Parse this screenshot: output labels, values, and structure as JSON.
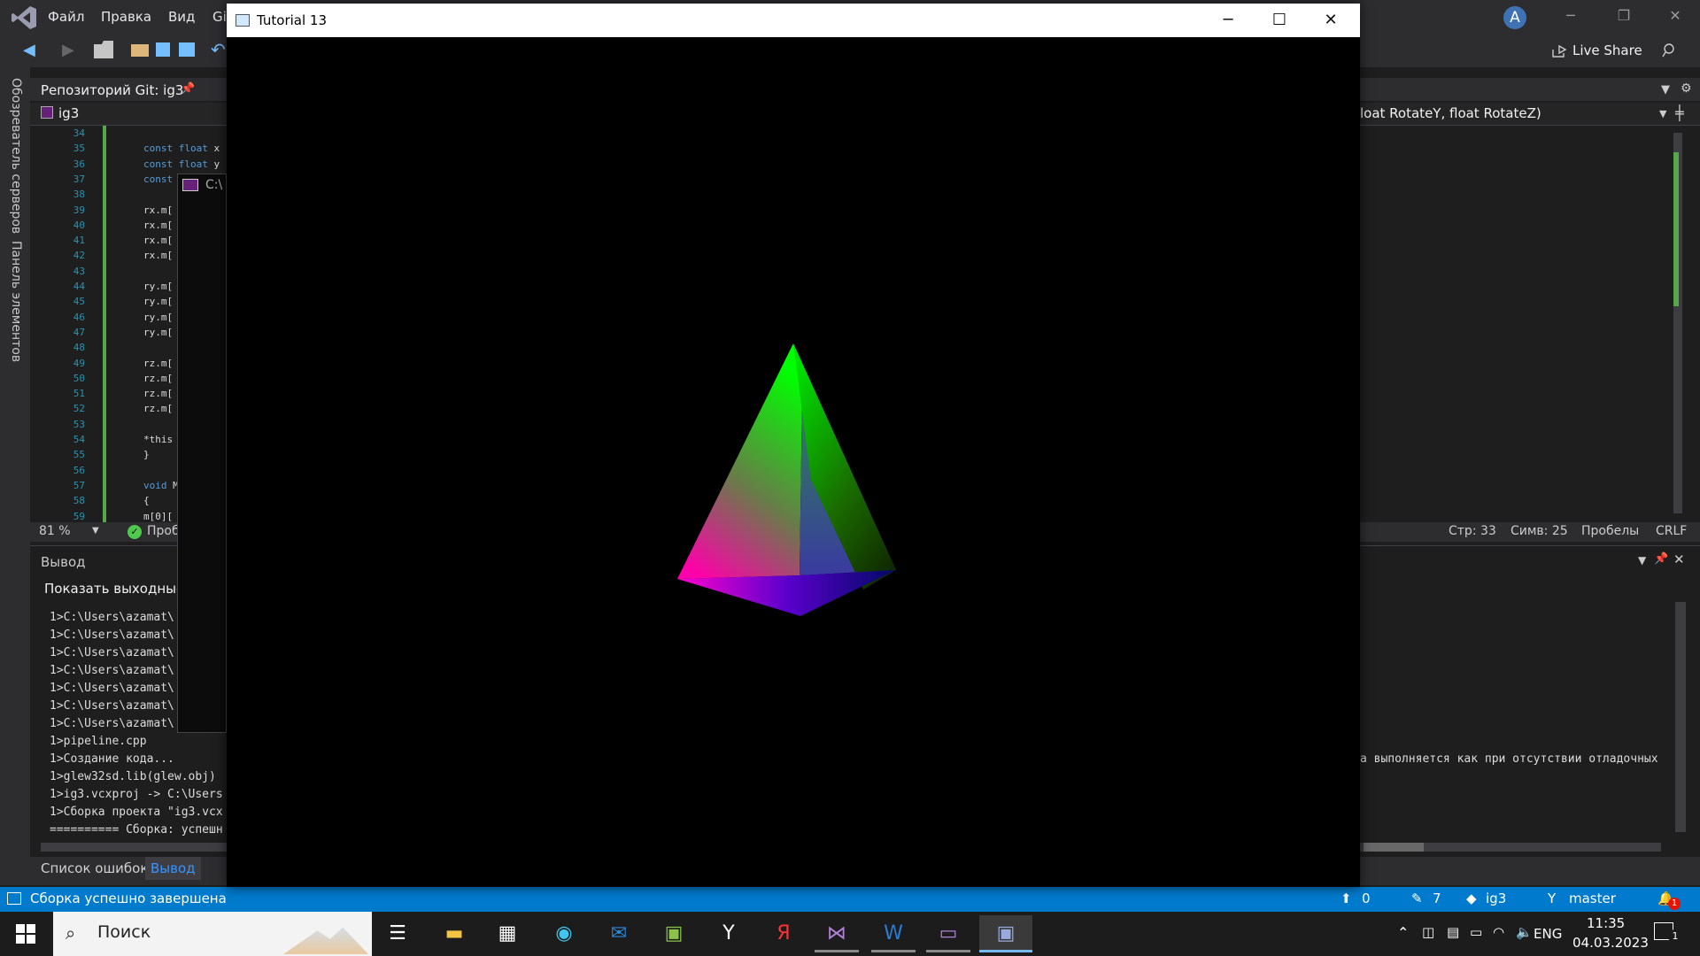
{
  "menu": [
    "Файл",
    "Правка",
    "Вид",
    "Git"
  ],
  "titlebar_controls": {
    "minimize": "─",
    "restore": "❐",
    "close": "✕"
  },
  "avatar_initial": "A",
  "live_share": "Live Share",
  "left_strip": {
    "server_explorer": "Обозреватель серверов",
    "toolbox": "Панель элементов"
  },
  "git_tab": "Репозиторий Git: ig3",
  "nav": {
    "project": "ig3",
    "member": "loat RotateY, float RotateZ)"
  },
  "editor": {
    "lines": [
      {
        "n": "34",
        "t": ""
      },
      {
        "n": "35",
        "t": "const float x"
      },
      {
        "n": "36",
        "t": "const float y"
      },
      {
        "n": "37",
        "t": "const"
      },
      {
        "n": "38",
        "t": ""
      },
      {
        "n": "39",
        "t": "rx.m["
      },
      {
        "n": "40",
        "t": "rx.m["
      },
      {
        "n": "41",
        "t": "rx.m["
      },
      {
        "n": "42",
        "t": "rx.m["
      },
      {
        "n": "43",
        "t": ""
      },
      {
        "n": "44",
        "t": "ry.m["
      },
      {
        "n": "45",
        "t": "ry.m["
      },
      {
        "n": "46",
        "t": "ry.m["
      },
      {
        "n": "47",
        "t": "ry.m["
      },
      {
        "n": "48",
        "t": ""
      },
      {
        "n": "49",
        "t": "rz.m["
      },
      {
        "n": "50",
        "t": "rz.m["
      },
      {
        "n": "51",
        "t": "rz.m["
      },
      {
        "n": "52",
        "t": "rz.m["
      },
      {
        "n": "53",
        "t": ""
      },
      {
        "n": "54",
        "t": "*this"
      },
      {
        "n": "55",
        "t": "}"
      },
      {
        "n": "56",
        "t": ""
      },
      {
        "n": "57",
        "t": "void Matr"
      },
      {
        "n": "58",
        "t": "{"
      },
      {
        "n": "59",
        "t": "m[0]["
      }
    ]
  },
  "editor_status": {
    "zoom": "81 %",
    "issues": "Проб",
    "line": "Стр: 33",
    "col": "Симв: 25",
    "spaces": "Пробелы",
    "eol": "CRLF"
  },
  "output": {
    "title": "Вывод",
    "source_label": "Показать выходные д",
    "lines": [
      "1>C:\\Users\\azamat\\",
      "1>C:\\Users\\azamat\\",
      "1>C:\\Users\\azamat\\",
      "1>C:\\Users\\azamat\\",
      "1>C:\\Users\\azamat\\",
      "1>C:\\Users\\azamat\\",
      "1>C:\\Users\\azamat\\",
      "1>pipeline.cpp",
      "1>Создание кода...",
      "1>glew32sd.lib(glew.obj)",
      "1>ig3.vcxproj -> C:\\Users",
      "1>Сборка проекта \"ig3.vcx",
      "========== Сборка: успешн"
    ],
    "right_text": "а выполняется как при отсутствии отладочных"
  },
  "bottom_tabs": {
    "errors": "Список ошибок",
    "output": "Вывод"
  },
  "statusbar": {
    "message": "Сборка успешно завершена",
    "up": "0",
    "edits": "7",
    "repo": "ig3",
    "branch": "master",
    "notif": "1"
  },
  "tutorial_window": {
    "title": "Tutorial 13",
    "cmd_label": "C:\\"
  },
  "taskbar": {
    "search": "Поиск",
    "lang": "ENG",
    "time": "11:35",
    "date": "04.03.2023",
    "notif_count": "1"
  },
  "colors": {
    "vs_blue": "#007acc",
    "accent_purple": "#68217a"
  }
}
